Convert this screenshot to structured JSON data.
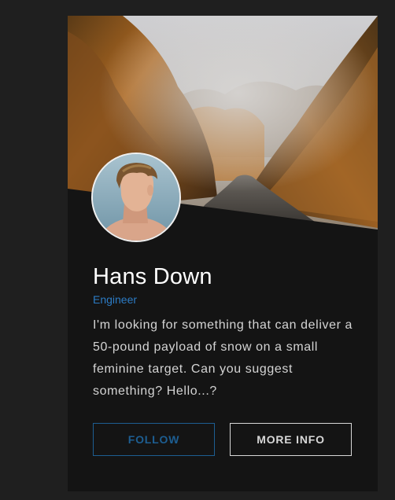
{
  "profile": {
    "name": "Hans Down",
    "title": "Engineer",
    "bio": "I'm looking for something that can deliver a 50-pound payload of snow on a small feminine target. Can you suggest something? Hello...?"
  },
  "actions": {
    "follow_label": "FOLLOW",
    "more_info_label": "MORE INFO"
  },
  "colors": {
    "page_background": "#1f1f1f",
    "card_background": "#141414",
    "accent_blue": "#2c7bc4",
    "follow_border": "#1d5e92",
    "text_light": "#d4d4d4"
  }
}
